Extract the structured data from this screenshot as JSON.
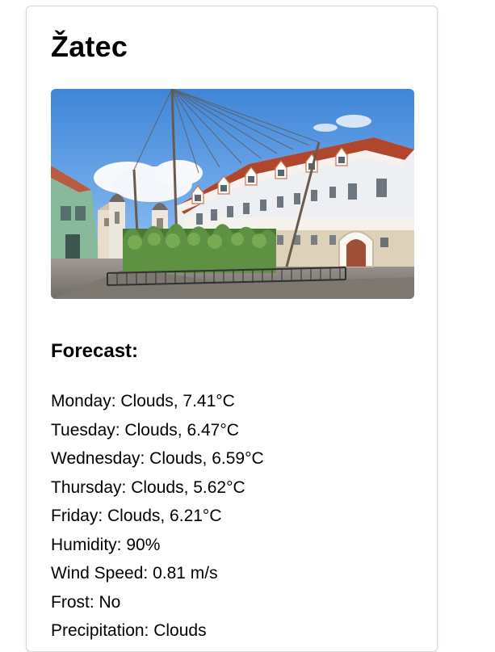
{
  "city": {
    "name": "Žatec"
  },
  "photo": {
    "subject": "street-view-hop-garden"
  },
  "forecast": {
    "heading": "Forecast:",
    "lines": [
      "Monday: Clouds, 7.41°C",
      "Tuesday: Clouds, 6.47°C",
      "Wednesday: Clouds, 6.59°C",
      "Thursday: Clouds, 5.62°C",
      "Friday: Clouds, 6.21°C",
      "Humidity: 90%",
      "Wind Speed: 0.81 m/s",
      "Frost: No",
      "Precipitation: Clouds"
    ]
  }
}
